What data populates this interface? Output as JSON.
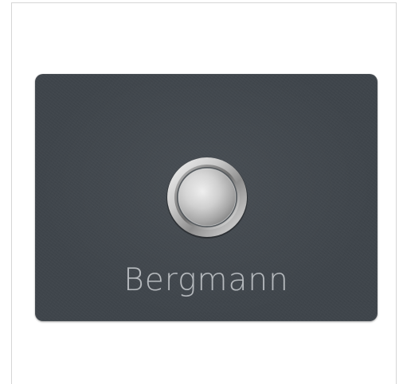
{
  "nameplate": {
    "name": "Bergmann",
    "plate_color": "#3f454b",
    "engraving_color": "#b5b9bd",
    "button_icon": "doorbell-button-icon"
  }
}
